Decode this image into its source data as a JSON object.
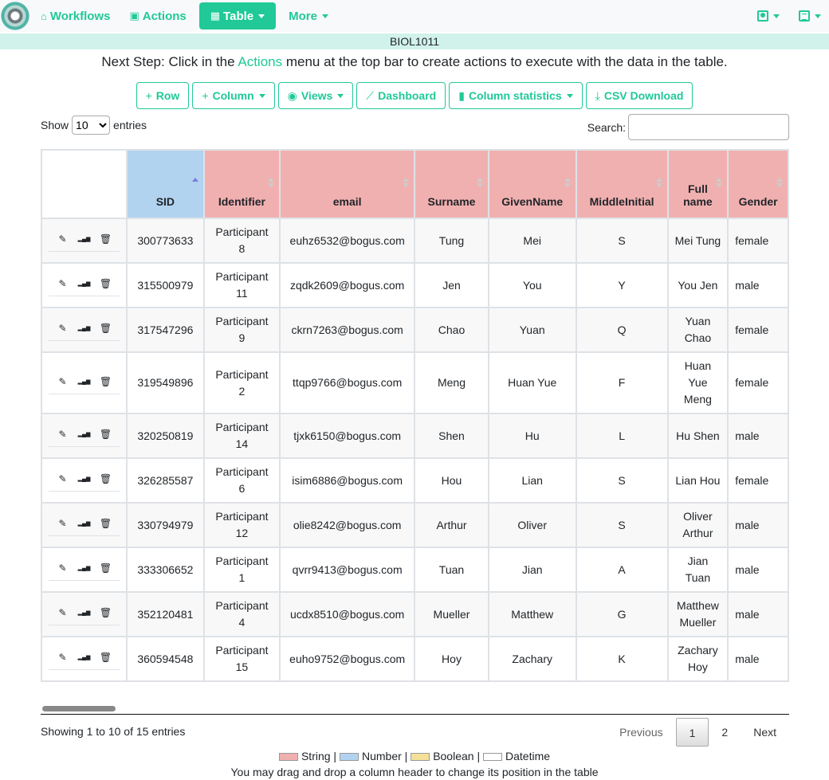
{
  "navbar": {
    "items": [
      {
        "label": "Workflows",
        "icon": "home-icon"
      },
      {
        "label": "Actions",
        "icon": "comment-icon"
      },
      {
        "label": "Table",
        "icon": "table-icon",
        "active": true
      },
      {
        "label": "More"
      }
    ],
    "right": [
      "user-icon",
      "list-icon"
    ]
  },
  "course": "BIOL1011",
  "next_step": {
    "prefix": "Next Step:",
    "before": " Click in the ",
    "link": "Actions",
    "after": " menu at the top bar to create actions to execute with the data in the table."
  },
  "toolbar": {
    "row": "Row",
    "column": "Column",
    "views": "Views",
    "dashboard": "Dashboard",
    "stats": "Column statistics",
    "csv": "CSV Download"
  },
  "controls": {
    "show": "Show",
    "entries": "entries",
    "page_size": "10",
    "search_label": "Search:",
    "search_value": ""
  },
  "columns": [
    {
      "label": "",
      "type": "blank"
    },
    {
      "label": "SID",
      "type": "num",
      "sort": "asc"
    },
    {
      "label": "Identifier",
      "type": "str"
    },
    {
      "label": "email",
      "type": "str"
    },
    {
      "label": "Surname",
      "type": "str"
    },
    {
      "label": "GivenName",
      "type": "str"
    },
    {
      "label": "MiddleInitial",
      "type": "str"
    },
    {
      "label": "Full name",
      "type": "str"
    },
    {
      "label": "Gender",
      "type": "str"
    }
  ],
  "rows": [
    [
      "300773633",
      "Participant 8",
      "euhz6532@bogus.com",
      "Tung",
      "Mei",
      "S",
      "Mei Tung",
      "female"
    ],
    [
      "315500979",
      "Participant 11",
      "zqdk2609@bogus.com",
      "Jen",
      "You",
      "Y",
      "You Jen",
      "male"
    ],
    [
      "317547296",
      "Participant 9",
      "ckrn7263@bogus.com",
      "Chao",
      "Yuan",
      "Q",
      "Yuan Chao",
      "female"
    ],
    [
      "319549896",
      "Participant 2",
      "ttqp9766@bogus.com",
      "Meng",
      "Huan Yue",
      "F",
      "Huan Yue Meng",
      "female"
    ],
    [
      "320250819",
      "Participant 14",
      "tjxk6150@bogus.com",
      "Shen",
      "Hu",
      "L",
      "Hu Shen",
      "male"
    ],
    [
      "326285587",
      "Participant 6",
      "isim6886@bogus.com",
      "Hou",
      "Lian",
      "S",
      "Lian Hou",
      "female"
    ],
    [
      "330794979",
      "Participant 12",
      "olie8242@bogus.com",
      "Arthur",
      "Oliver",
      "S",
      "Oliver Arthur",
      "male"
    ],
    [
      "333306652",
      "Participant 1",
      "qvrr9413@bogus.com",
      "Tuan",
      "Jian",
      "A",
      "Jian Tuan",
      "male"
    ],
    [
      "352120481",
      "Participant 4",
      "ucdx8510@bogus.com",
      "Mueller",
      "Matthew",
      "G",
      "Matthew Mueller",
      "male"
    ],
    [
      "360594548",
      "Participant 15",
      "euho9752@bogus.com",
      "Hoy",
      "Zachary",
      "K",
      "Zachary Hoy",
      "male"
    ]
  ],
  "footer": {
    "info": "Showing 1 to 10 of 15 entries",
    "previous": "Previous",
    "pages": [
      "1",
      "2"
    ],
    "current": "1",
    "next": "Next"
  },
  "legend": [
    {
      "label": "String",
      "color": "#f1b0b0"
    },
    {
      "label": "Number",
      "color": "#b2d3f0"
    },
    {
      "label": "Boolean",
      "color": "#f5e09a"
    },
    {
      "label": "Datetime",
      "color": "#ffffff"
    }
  ],
  "note": "You may drag and drop a column header to change its position in the table"
}
